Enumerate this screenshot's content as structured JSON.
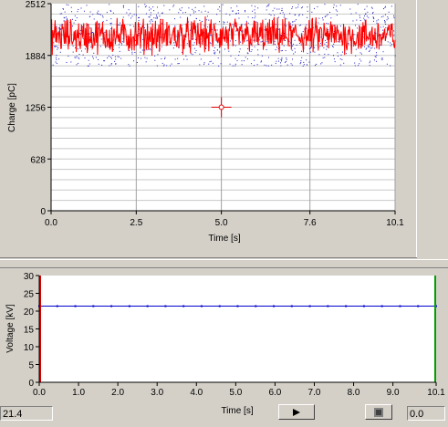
{
  "charge_chart": {
    "ylabel": "Charge [pC]",
    "xlabel": "Time [s]",
    "yticks": [
      "0",
      "628",
      "1256",
      "1884",
      "2512"
    ],
    "xticks": [
      "0.0",
      "2.5",
      "5.0",
      "7.6",
      "10.1"
    ],
    "cursor_marker": {
      "x": 5.0,
      "y": 1256
    }
  },
  "voltage_chart": {
    "ylabel": "Voltage [kV]",
    "xlabel": "Time [s]",
    "yticks": [
      "0",
      "5",
      "10",
      "15",
      "20",
      "25",
      "30"
    ],
    "xticks": [
      "0.0",
      "1.0",
      "2.0",
      "3.0",
      "4.0",
      "5.0",
      "6.0",
      "7.0",
      "8.0",
      "9.0",
      "10.1"
    ],
    "level": 21.4
  },
  "controls": {
    "voltage_readout": "21.4",
    "time_readout": "0.0",
    "play_icon": "play-icon",
    "stop_icon": "stop-icon"
  },
  "chart_data": [
    {
      "type": "line",
      "xlabel": "Time [s]",
      "ylabel": "Charge [pC]",
      "xlim": [
        0,
        10.1
      ],
      "ylim": [
        0,
        2512
      ],
      "series": [
        {
          "values_summary": {
            "mean": 2120,
            "min": 1680,
            "max": 2480
          },
          "color": "#ff0000"
        },
        {
          "values_summary": {
            "mean": 2120,
            "min": 1760,
            "max": 2512
          },
          "color": "#0000cc",
          "style": "points"
        }
      ]
    },
    {
      "type": "line",
      "xlabel": "Time [s]",
      "ylabel": "Voltage [kV]",
      "xlim": [
        0,
        10.1
      ],
      "ylim": [
        0,
        30
      ],
      "series": [
        {
          "x": [
            0.0,
            10.1
          ],
          "values": [
            21.4,
            21.4
          ],
          "color": "#0000cc"
        }
      ]
    }
  ]
}
